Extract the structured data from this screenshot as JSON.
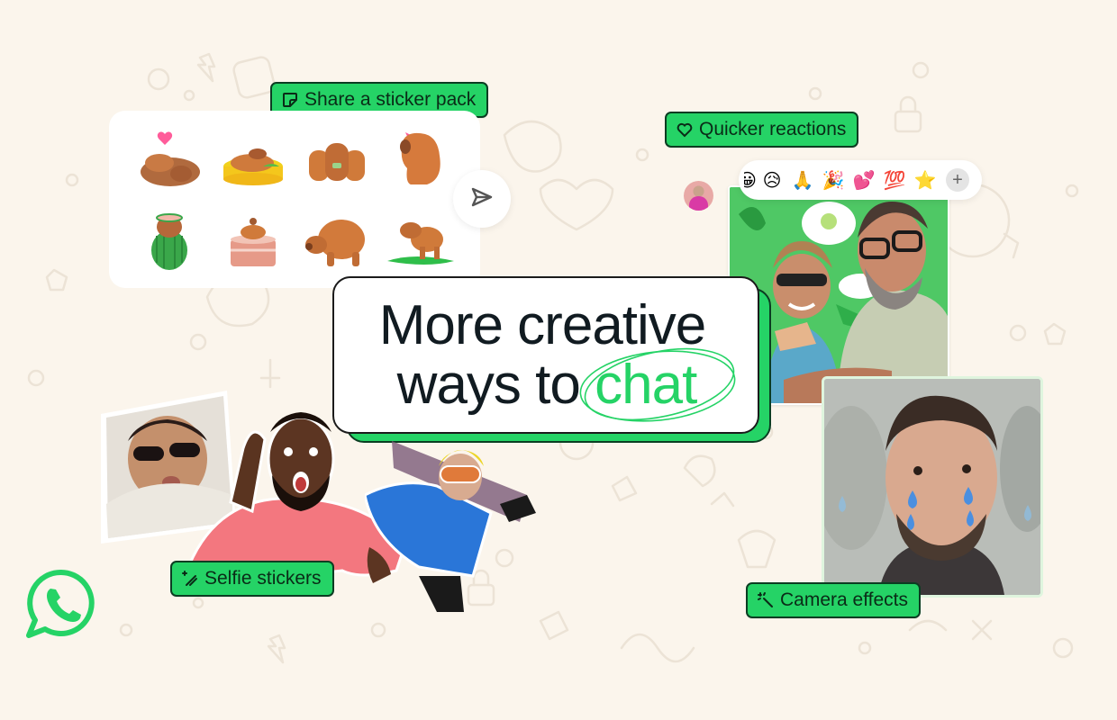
{
  "brand": {
    "name": "WhatsApp",
    "logo_icon": "whatsapp-logo-icon",
    "accent_color": "#25D366",
    "background_color": "#FBF5EC",
    "text_color": "#111B21"
  },
  "headline": {
    "line1": "More creative",
    "line2_prefix": "ways to",
    "line2_accent": "chat"
  },
  "features": [
    {
      "id": "share-sticker-pack",
      "label": "Share a sticker pack",
      "icon": "sticker-icon"
    },
    {
      "id": "quicker-reactions",
      "label": "Quicker reactions",
      "icon": "heart-outline-icon"
    },
    {
      "id": "selfie-stickers",
      "label": "Selfie stickers",
      "icon": "magic-wand-sparkle-icon"
    },
    {
      "id": "camera-effects",
      "label": "Camera effects",
      "icon": "magic-wand-icon"
    }
  ],
  "sticker_pack": {
    "stickers": [
      "capybara-with-heart",
      "capybara-in-hot-tub",
      "capybara-family",
      "capybara-with-butterfly",
      "capybara-in-watermelon",
      "capybara-in-bath-tub",
      "capybara-walking",
      "capybara-on-crocodile"
    ],
    "send_icon": "send-icon"
  },
  "reactions": {
    "emojis": [
      "😀",
      "😥",
      "🙏",
      "🎉",
      "💕",
      "💯",
      "⭐"
    ],
    "more_label": "+"
  },
  "photos": {
    "green_background_photo": "couple-selfie-with-green-background",
    "camera_effect_photo": "man-with-tears-effect"
  },
  "selfie_stickers": [
    "woman-in-fur-hood",
    "surprised-man-pink-shirt",
    "snowboarder-in-blue-jacket"
  ]
}
